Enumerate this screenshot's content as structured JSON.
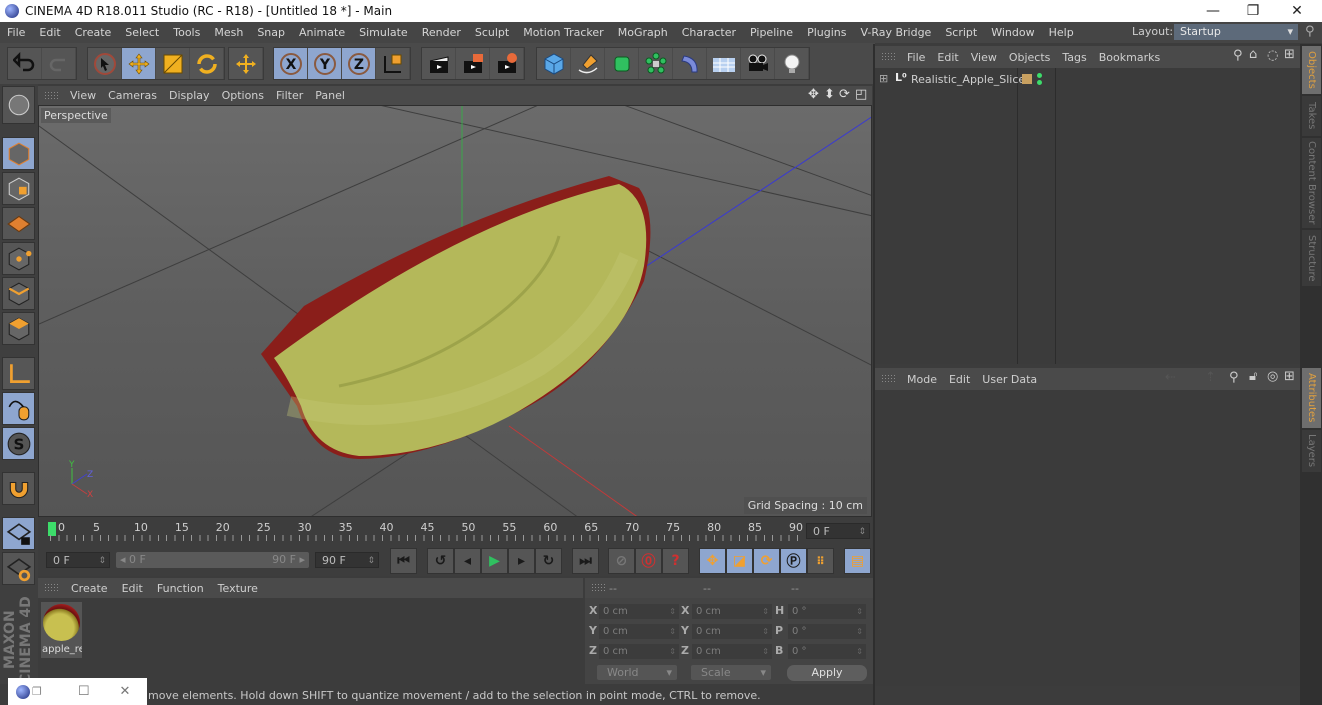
{
  "window": {
    "title": "CINEMA 4D R18.011 Studio (RC - R18) - [Untitled 18 *] - Main",
    "controls": {
      "minimize": "—",
      "restore": "❐",
      "close": "✕"
    }
  },
  "menubar": {
    "items": [
      "File",
      "Edit",
      "Create",
      "Select",
      "Tools",
      "Mesh",
      "Snap",
      "Animate",
      "Simulate",
      "Render",
      "Sculpt",
      "Motion Tracker",
      "MoGraph",
      "Character",
      "Pipeline",
      "Plugins",
      "V-Ray Bridge",
      "Script",
      "Window",
      "Help"
    ],
    "layout_label": "Layout:",
    "layout_value": "Startup"
  },
  "toolbar": {
    "icons": [
      "undo-icon",
      "redo-icon",
      "live-selection-icon",
      "move-icon",
      "scale-icon",
      "rotate-icon",
      "recent-tool-icon",
      "x-axis-lock-icon",
      "y-axis-lock-icon",
      "z-axis-lock-icon",
      "coordinate-system-icon",
      "render-view-icon",
      "render-to-picture-viewer-icon",
      "render-settings-icon",
      "cube-object-icon",
      "spline-pen-icon",
      "subdivision-surface-icon",
      "cloner-icon",
      "deformer-icon",
      "floor-icon",
      "camera-icon",
      "light-icon"
    ]
  },
  "viewport": {
    "menu": [
      "View",
      "Cameras",
      "Display",
      "Options",
      "Filter",
      "Panel"
    ],
    "camera_label": "Perspective",
    "grid_spacing": "Grid Spacing : 10 cm",
    "axis_labels": {
      "x": "X",
      "y": "Y",
      "z": "Z"
    },
    "object": "Realistic_Apple_Slice"
  },
  "timeline": {
    "ticks": [
      "0",
      "5",
      "10",
      "15",
      "20",
      "25",
      "30",
      "35",
      "40",
      "45",
      "50",
      "55",
      "60",
      "65",
      "70",
      "75",
      "80",
      "85",
      "90"
    ],
    "current_frame": "0 F",
    "start_frame": "0 F",
    "range_start": "0 F",
    "range_end": "90 F",
    "end_frame": "90 F"
  },
  "material_manager": {
    "menu": [
      "Create",
      "Edit",
      "Function",
      "Texture"
    ],
    "materials": [
      {
        "name": "apple_re"
      }
    ]
  },
  "coordinates": {
    "headers": [
      "--",
      "--",
      "--"
    ],
    "rows": [
      {
        "p_label": "X",
        "p_value": "0 cm",
        "s_label": "X",
        "s_value": "0 cm",
        "r_label": "H",
        "r_value": "0 °"
      },
      {
        "p_label": "Y",
        "p_value": "0 cm",
        "s_label": "Y",
        "s_value": "0 cm",
        "r_label": "P",
        "r_value": "0 °"
      },
      {
        "p_label": "Z",
        "p_value": "0 cm",
        "s_label": "Z",
        "s_value": "0 cm",
        "r_label": "B",
        "r_value": "0 °"
      }
    ],
    "space_dropdown": "World",
    "mode_dropdown": "Scale",
    "apply_label": "Apply"
  },
  "object_manager": {
    "menu": [
      "File",
      "Edit",
      "View",
      "Objects",
      "Tags",
      "Bookmarks"
    ],
    "objects": [
      {
        "name": "Realistic_Apple_Slice",
        "tag_color": "#c8a060"
      }
    ]
  },
  "attribute_manager": {
    "menu": [
      "Mode",
      "Edit",
      "User Data"
    ]
  },
  "side_tabs": {
    "top": [
      "Objects",
      "Takes",
      "Content Browser",
      "Structure"
    ],
    "bottom": [
      "Attributes",
      "Layers"
    ]
  },
  "branding": "MAXON CINEMA 4D",
  "status": "move elements. Hold down SHIFT to quantize movement / add to the selection in point mode, CTRL to remove.",
  "colors": {
    "accent_selected": "#8ea6cf",
    "tab_active_text": "#e0a040",
    "frame_marker": "#3ddc6a"
  }
}
